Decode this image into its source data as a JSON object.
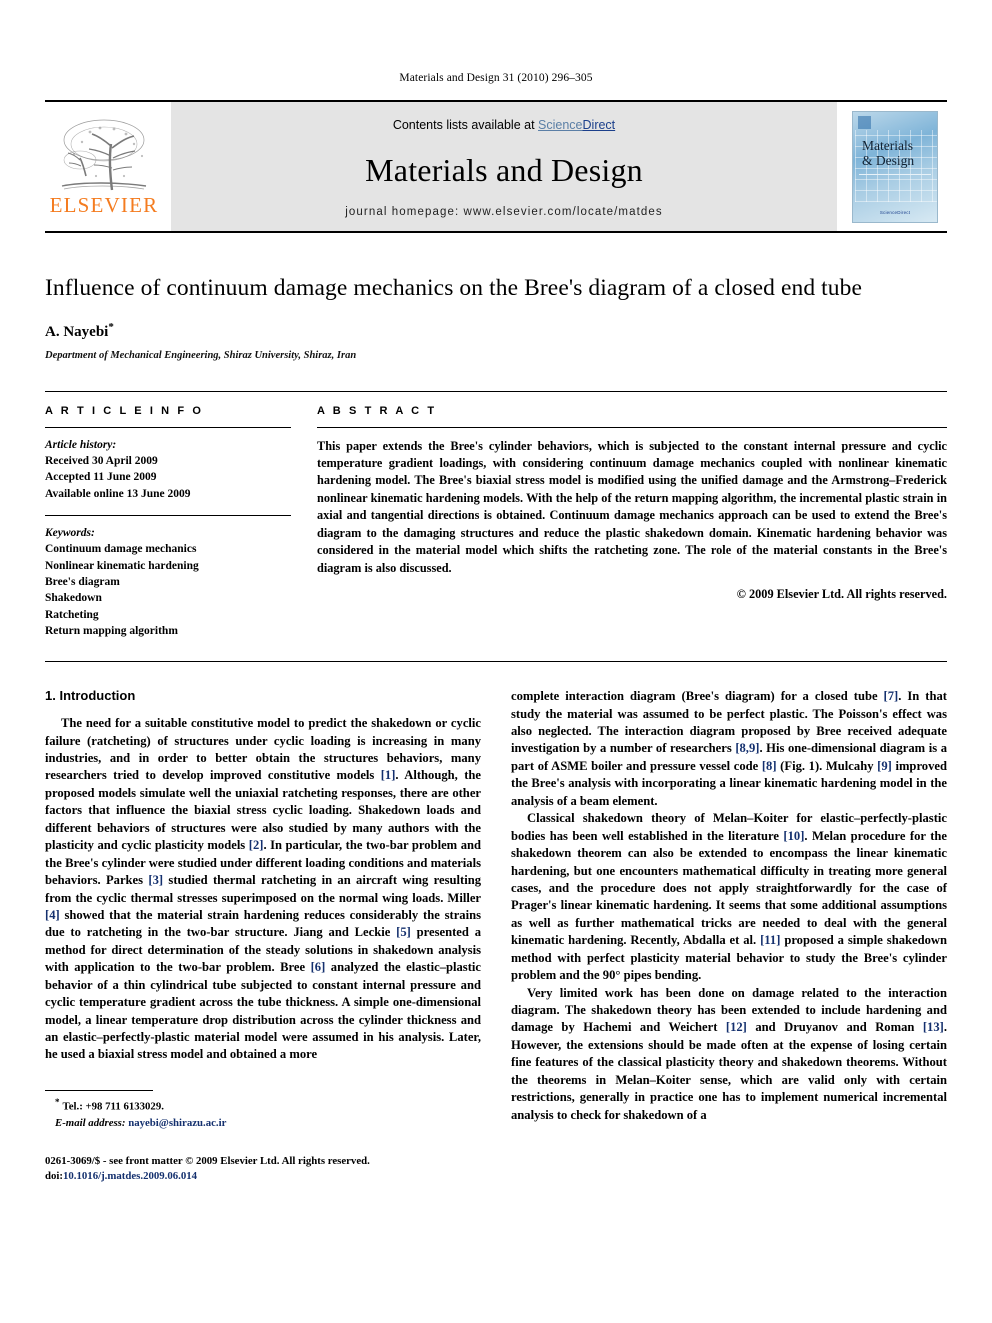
{
  "running_head": "Materials and Design 31 (2010) 296–305",
  "masthead": {
    "publisher_logo_text": "ELSEVIER",
    "contents_prefix": "Contents lists available at ",
    "sciencedirect_science": "Science",
    "sciencedirect_direct": "Direct",
    "journal_name": "Materials and Design",
    "homepage": "journal homepage: www.elsevier.com/locate/matdes",
    "cover": {
      "title_line1": "Materials",
      "title_line2": "& Design",
      "footer_text": "ScienceDirect"
    }
  },
  "article": {
    "title": "Influence of continuum damage mechanics on the Bree's diagram of a closed end tube",
    "author": "A. Nayebi",
    "author_marker": "*",
    "affiliation": "Department of Mechanical Engineering, Shiraz University, Shiraz, Iran"
  },
  "article_info": {
    "heading": "A R T I C L E   I N F O",
    "history_label": "Article history:",
    "history": [
      "Received 30 April 2009",
      "Accepted 11 June 2009",
      "Available online 13 June 2009"
    ],
    "keywords_label": "Keywords:",
    "keywords": [
      "Continuum damage mechanics",
      "Nonlinear kinematic hardening",
      "Bree's diagram",
      "Shakedown",
      "Ratcheting",
      "Return mapping algorithm"
    ]
  },
  "abstract": {
    "heading": "A B S T R A C T",
    "text": "This paper extends the Bree's cylinder behaviors, which is subjected to the constant internal pressure and cyclic temperature gradient loadings, with considering continuum damage mechanics coupled with nonlinear kinematic hardening model. The Bree's biaxial stress model is modified using the unified damage and the Armstrong–Frederick nonlinear kinematic hardening models. With the help of the return mapping algorithm, the incremental plastic strain in axial and tangential directions is obtained. Continuum damage mechanics approach can be used to extend the Bree's diagram to the damaging structures and reduce the plastic shakedown domain. Kinematic hardening behavior was considered in the material model which shifts the ratcheting zone. The role of the material constants in the Bree's diagram is also discussed.",
    "copyright": "© 2009 Elsevier Ltd. All rights reserved."
  },
  "body": {
    "section_heading": "1. Introduction",
    "left_para_1_a": "The need for a suitable constitutive model to predict the shakedown or cyclic failure (ratcheting) of structures under cyclic loading is increasing in many industries, and in order to better obtain the structures behaviors, many researchers tried to develop improved constitutive models ",
    "left_ref_1": "[1]",
    "left_para_1_b": ". Although, the proposed models simulate well the uniaxial ratcheting responses, there are other factors that influence the biaxial stress cyclic loading. Shakedown loads and different behaviors of structures were also studied by many authors with the plasticity and cyclic plasticity models ",
    "left_ref_2": "[2]",
    "left_para_1_c": ". In particular, the two-bar problem and the Bree's cylinder were studied under different loading conditions and materials behaviors. Parkes ",
    "left_ref_3": "[3]",
    "left_para_1_d": " studied thermal ratcheting in an aircraft wing resulting from the cyclic thermal stresses superimposed on the normal wing loads. Miller ",
    "left_ref_4": "[4]",
    "left_para_1_e": " showed that the material strain hardening reduces considerably the strains due to ratcheting in the two-bar structure. Jiang and Leckie ",
    "left_ref_5": "[5]",
    "left_para_1_f": " presented a method for direct determination of the steady solutions in shakedown analysis with application to the two-bar problem. Bree ",
    "left_ref_6": "[6]",
    "left_para_1_g": " analyzed the elastic–plastic behavior of a thin cylindrical tube subjected to constant internal pressure and cyclic temperature gradient across the tube thickness. A simple one-dimensional model, a linear temperature drop distribution across the cylinder thickness and an elastic–perfectly-plastic material model were assumed in his analysis. Later, he used a biaxial stress model and obtained a more",
    "right_para_1_a": "complete interaction diagram (Bree's diagram) for a closed tube ",
    "right_ref_7": "[7]",
    "right_para_1_b": ". In that study the material was assumed to be perfect plastic. The Poisson's effect was also neglected. The interaction diagram proposed by Bree received adequate investigation by a number of researchers ",
    "right_ref_89": "[8,9]",
    "right_para_1_c": ". His one-dimensional diagram is a part of ASME boiler and pressure vessel code ",
    "right_ref_8": "[8]",
    "right_para_1_d": " (Fig. 1). Mulcahy ",
    "right_ref_9": "[9]",
    "right_para_1_e": " improved the Bree's analysis with incorporating a linear kinematic hardening model in the analysis of a beam element.",
    "right_para_2_a": "Classical shakedown theory of Melan–Koiter for elastic–perfectly-plastic bodies has been well established in the literature ",
    "right_ref_10": "[10]",
    "right_para_2_b": ". Melan procedure for the shakedown theorem can also be extended to encompass the linear kinematic hardening, but one encounters mathematical difficulty in treating more general cases, and the procedure does not apply straightforwardly for the case of Prager's linear kinematic hardening. It seems that some additional assumptions as well as further mathematical tricks are needed to deal with the general kinematic hardening. Recently, Abdalla et al. ",
    "right_ref_11": "[11]",
    "right_para_2_c": " proposed a simple shakedown method with perfect plasticity material behavior to study the Bree's cylinder problem and the 90° pipes bending.",
    "right_para_3_a": "Very limited work has been done on damage related to the interaction diagram. The shakedown theory has been extended to include hardening and damage by Hachemi and Weichert ",
    "right_ref_12": "[12]",
    "right_para_3_b": " and Druyanov and Roman ",
    "right_ref_13": "[13]",
    "right_para_3_c": ". However, the extensions should be made often at the expense of losing certain fine features of the classical plasticity theory and shakedown theorems. Without the theorems in Melan–Koiter sense, which are valid only with certain restrictions, generally in practice one has to implement numerical incremental analysis to check for shakedown of a"
  },
  "footnotes": {
    "marker": "*",
    "tel": "Tel.: +98 711 6133029.",
    "email_label": "E-mail address:",
    "email": "nayebi@shirazu.ac.ir",
    "issn_line": "0261-3069/$ - see front matter © 2009 Elsevier Ltd. All rights reserved.",
    "doi_label": "doi:",
    "doi": "10.1016/j.matdes.2009.06.014"
  },
  "colors": {
    "link": "#14306e",
    "elsevier_orange": "#f47c20",
    "sciencedirect_blue": "#1b3f8b"
  }
}
